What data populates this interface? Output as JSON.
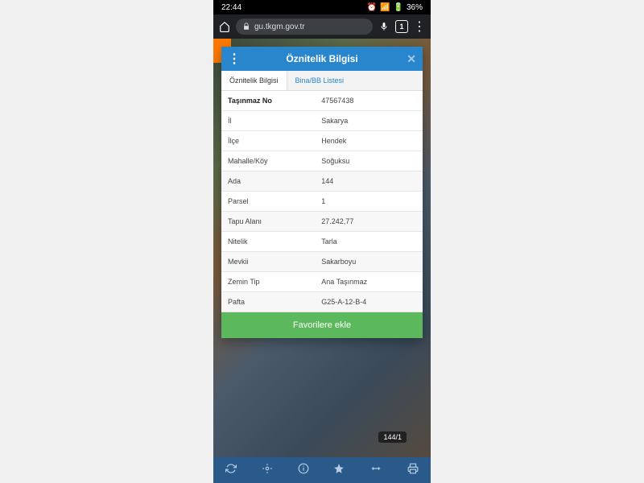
{
  "status": {
    "time": "22:44",
    "battery": "36%"
  },
  "browser": {
    "url": "gu.tkgm.gov.tr",
    "tab_count": "1"
  },
  "modal": {
    "title": "Öznitelik Bilgisi",
    "tabs": [
      {
        "label": "Öznitelik Bilgisi",
        "active": true
      },
      {
        "label": "Bina/BB Listesi",
        "active": false
      }
    ],
    "rows": [
      {
        "k": "Taşınmaz No",
        "v": "47567438"
      },
      {
        "k": "İl",
        "v": "Sakarya"
      },
      {
        "k": "İlçe",
        "v": "Hendek"
      },
      {
        "k": "Mahalle/Köy",
        "v": "Soğuksu"
      },
      {
        "k": "Ada",
        "v": "144"
      },
      {
        "k": "Parsel",
        "v": "1"
      },
      {
        "k": "Tapu Alanı",
        "v": "27.242,77"
      },
      {
        "k": "Nitelik",
        "v": "Tarla"
      },
      {
        "k": "Mevkii",
        "v": "Sakarboyu"
      },
      {
        "k": "Zemin Tip",
        "v": "Ana Taşınmaz"
      },
      {
        "k": "Pafta",
        "v": "G25-A-12-B-4"
      }
    ],
    "favorite_label": "Favorilere ekle"
  },
  "map": {
    "parcel_label": "144/1"
  }
}
